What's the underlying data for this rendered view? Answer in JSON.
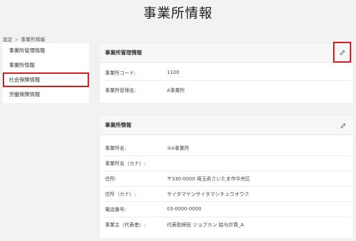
{
  "page_title": "事業所情報",
  "breadcrumb": {
    "parent": "設定",
    "separator": ">",
    "current": "事業所情報"
  },
  "sidebar": {
    "items": [
      {
        "label": "事業所管理情報"
      },
      {
        "label": "事業所情報"
      },
      {
        "label": "社会保険情報",
        "highlighted": true
      },
      {
        "label": "労働保険情報"
      }
    ]
  },
  "management_card": {
    "title": "事業所管理情報",
    "edit_icon": "pencil-icon",
    "rows": [
      {
        "label": "事業所コード:",
        "value": "1100"
      },
      {
        "label": "事業所管理名:",
        "value": "A事業所"
      }
    ]
  },
  "office_card": {
    "title": "事業所情報",
    "edit_icon": "pencil-icon",
    "rows": [
      {
        "label": "事業所名:",
        "value": "②A事業所"
      },
      {
        "label": "事業所名（カナ）:",
        "value": ""
      },
      {
        "label": "住所:",
        "value": "〒330-0000 埼玉県さいたま市中央区"
      },
      {
        "label": "住所（カナ）:",
        "value": "サイタマケンサイタマシチュウオウク"
      },
      {
        "label": "電話番号:",
        "value": "03-0000-0000"
      },
      {
        "label": "事業主（代表者）:",
        "value": "代表取締役 ジョブカン 給与計算_A"
      }
    ]
  },
  "colors": {
    "highlight": "#d71920",
    "background": "#f2f2f2",
    "card_header": "#f7f7f7"
  }
}
